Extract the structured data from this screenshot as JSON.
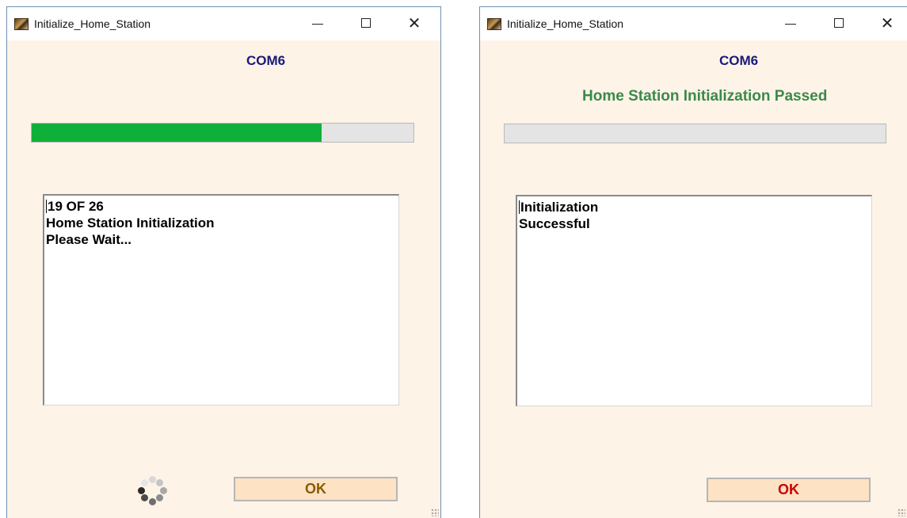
{
  "windows": [
    {
      "title": "Initialize_Home_Station",
      "port": "COM6",
      "status": "",
      "progress_fraction": 0.76,
      "log_lines": [
        "19 OF 26",
        "Home Station Initialization",
        "Please Wait..."
      ],
      "ok_label": "OK",
      "ok_color": "#8a5a00",
      "busy_indicator": true
    },
    {
      "title": "Initialize_Home_Station",
      "port": "COM6",
      "status": "Home Station Initialization Passed",
      "progress_fraction": 0.0,
      "log_lines": [
        "Initialization",
        "Successful"
      ],
      "ok_label": "OK",
      "ok_color": "#cc0000",
      "busy_indicator": false
    }
  ],
  "icons": {
    "app": "app-icon",
    "minimize": "minimize-icon",
    "maximize": "maximize-icon",
    "close": "close-icon",
    "busy": "loading-spinner-icon"
  },
  "colors": {
    "window_background": "#fdf3e7",
    "progress_fill": "#0fb03a",
    "port_label": "#1a1a7a",
    "status_label": "#3a8a4a"
  }
}
